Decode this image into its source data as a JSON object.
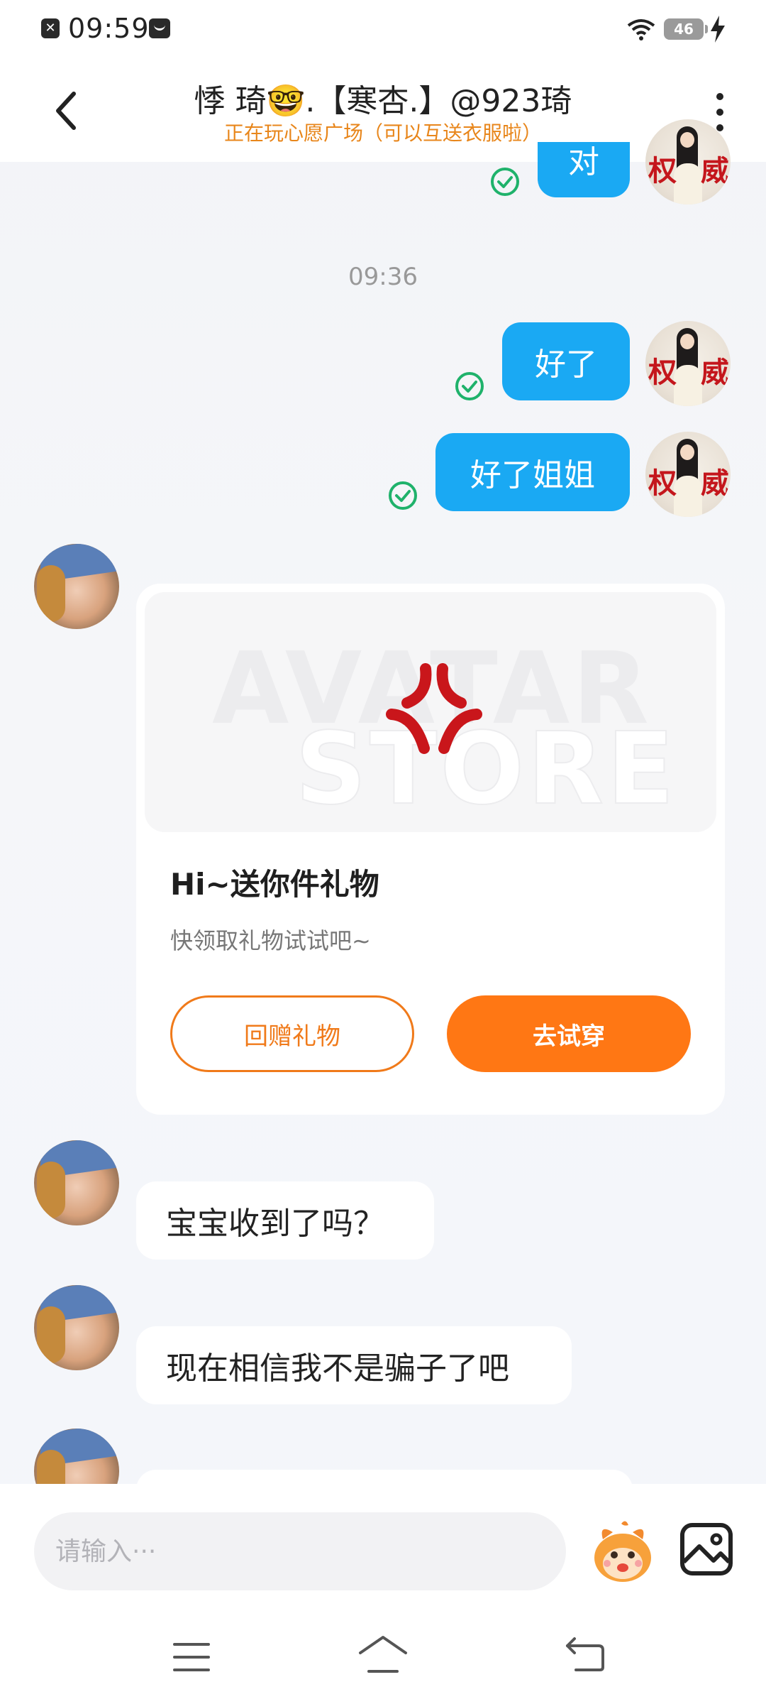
{
  "status_bar": {
    "time": "09:59",
    "battery": "46"
  },
  "header": {
    "title": "悸 琦🤓.【寒杏.】@923琦",
    "subtitle": "正在玩心愿广场（可以互送衣服啦）"
  },
  "messages": {
    "partial_top": "对",
    "timestamp": "09:36",
    "outgoing": [
      "好了",
      "好了姐姐"
    ],
    "self_avatar_stamp": [
      "权",
      "威"
    ],
    "incoming": [
      "宝宝收到了吗？",
      "现在相信我不是骗子了吧"
    ]
  },
  "gift_card": {
    "watermark_line1": "AVATAR",
    "watermark_line2": "STORE",
    "title": "Hi~送你件礼物",
    "description": "快领取礼物试试吧~",
    "return_button": "回赠礼物",
    "try_button": "去试穿"
  },
  "input": {
    "placeholder": "请输入···"
  },
  "colors": {
    "bubble_out": "#1aa9f3",
    "accent_orange": "#ff7714",
    "subtitle_orange": "#e8861b",
    "check_green": "#1fb26b"
  },
  "icons": [
    "back-icon",
    "more-icon",
    "check-icon",
    "anger-icon",
    "sticker-icon",
    "image-icon",
    "nav-menu-icon",
    "nav-home-icon",
    "nav-back-icon"
  ]
}
